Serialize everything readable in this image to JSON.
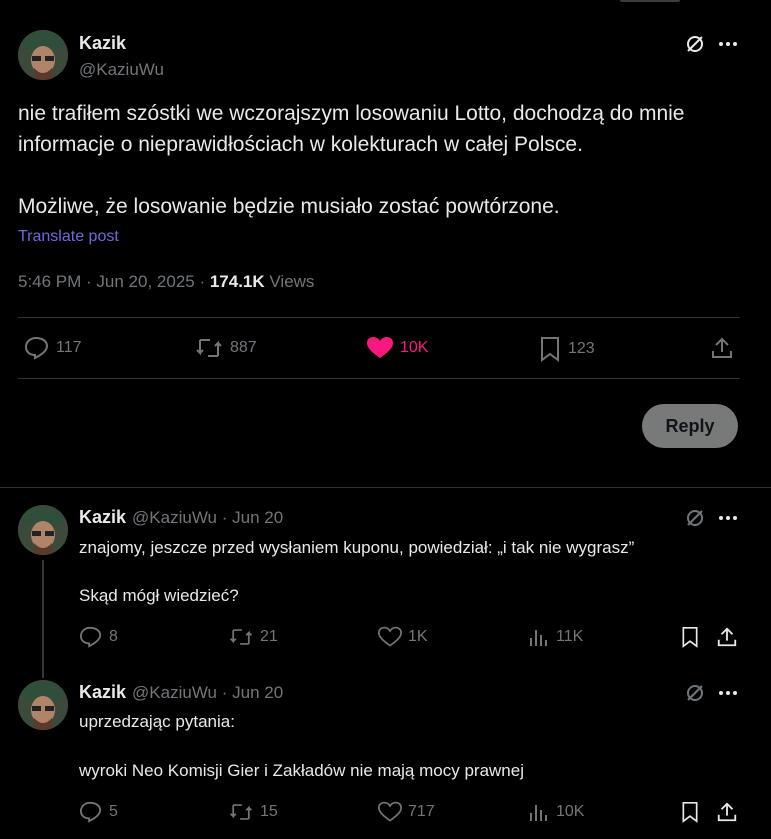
{
  "main_post": {
    "author_name": "Kazik",
    "author_handle": "@KaziuWu",
    "text_line_1": "nie trafiłem szóstki we wczorajszym losowaniu Lotto, dochodzą do mnie",
    "text_line_2": "informacje o nieprawidłościach w kolekturach w całej Polsce.",
    "text_line_3": "Możliwe, że losowanie będzie musiało zostać powtórzone.",
    "translate_label": "Translate post",
    "timestamp": "5:46 PM · Jun 20, 2025 · ",
    "views_count": "174.1K",
    "views_label": " Views",
    "replies": "117",
    "reposts": "887",
    "likes": "10K",
    "bookmarks": "123",
    "like_color": "#f91880"
  },
  "reply_box": {
    "button_label": "Reply"
  },
  "thread": [
    {
      "author_name": "Kazik",
      "author_handle": "@KaziuWu · Jun 20",
      "line_1": "znajomy, jeszcze przed wysłaniem kuponu, powiedział: „i tak nie wygrasz”",
      "line_2": "Skąd mógł wiedzieć?",
      "replies": "8",
      "reposts": "21",
      "likes": "1K",
      "views": "11K"
    },
    {
      "author_name": "Kazik",
      "author_handle": "@KaziuWu · Jun 20",
      "line_1": "uprzedzając pytania:",
      "line_2": "wyroki Neo Komisji Gier i Zakładów nie mają mocy prawnej",
      "replies": "5",
      "reposts": "15",
      "likes": "717",
      "views": "10K"
    }
  ]
}
